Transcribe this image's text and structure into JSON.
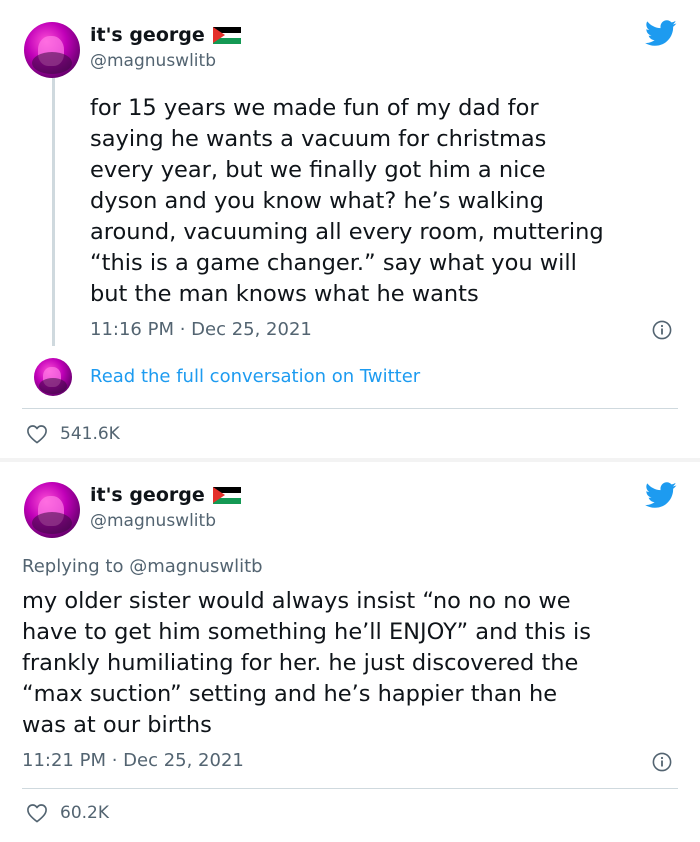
{
  "tweets": [
    {
      "display_name": "it's george",
      "handle": "@magnuswlitb",
      "text": "for 15 years we made fun of my dad for\nsaying he wants a vacuum for christmas\nevery year, but we finally got him a nice\ndyson and you know what? he’s walking\naround, vacuuming all every room, muttering\n“this is a game changer.” say what you will\nbut the man knows what he wants",
      "timestamp": "11:16 PM · Dec 25, 2021",
      "conversation_link": "Read the full conversation on Twitter",
      "likes": "541.6K"
    },
    {
      "display_name": "it's george",
      "handle": "@magnuswlitb",
      "replying_prefix": "Replying to",
      "replying_to": "@magnuswlitb",
      "text": "my older sister would always insist “no no no we\nhave to get him something he’ll ENJOY” and this is\nfrankly humiliating for her. he just discovered the\n“max suction” setting and he’s happier than he\nwas at our births",
      "timestamp": "11:21 PM · Dec 25, 2021",
      "likes": "60.2K"
    }
  ],
  "colors": {
    "twitter_blue": "#1d9bf0",
    "muted_text": "#536471",
    "text": "#0f1419",
    "divider": "#cfd9de"
  },
  "icons": [
    "twitter-bird-icon",
    "info-icon",
    "heart-icon",
    "palestine-flag-icon"
  ]
}
